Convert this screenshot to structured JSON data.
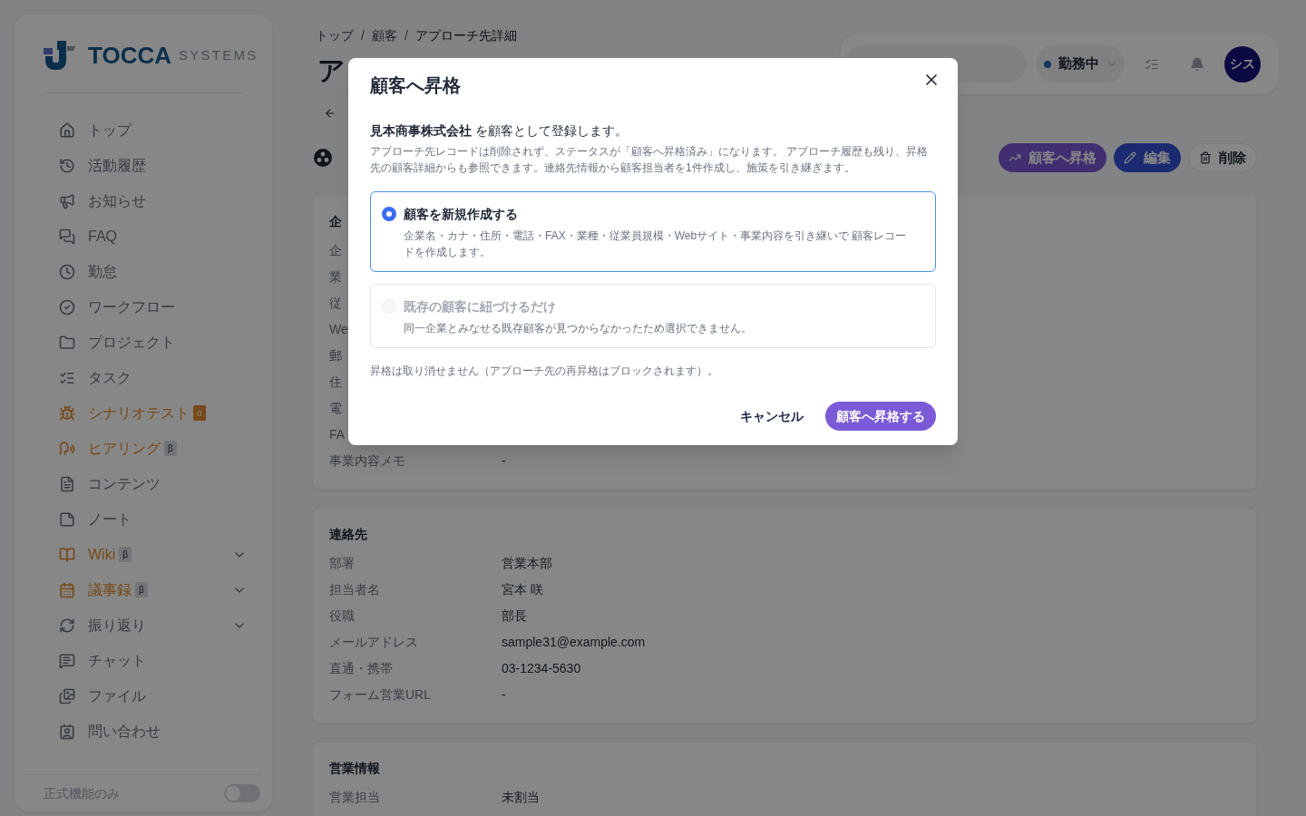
{
  "sidebar": {
    "logo": {
      "name": "TOCCA",
      "suffix": "SYSTEMS"
    },
    "items": [
      {
        "label": "トップ",
        "kind": "link"
      },
      {
        "label": "活動履歴",
        "kind": "link"
      },
      {
        "label": "お知らせ",
        "kind": "link"
      },
      {
        "label": "FAQ",
        "kind": "link"
      },
      {
        "label": "勤怠",
        "kind": "link"
      },
      {
        "label": "ワークフロー",
        "kind": "link"
      },
      {
        "label": "プロジェクト",
        "kind": "link"
      },
      {
        "label": "タスク",
        "kind": "link"
      },
      {
        "label": "シナリオテスト",
        "kind": "link",
        "badge": {
          "text": "α",
          "kind": "alpha"
        }
      },
      {
        "label": "ヒアリング",
        "kind": "link",
        "badge": {
          "text": "β",
          "kind": "beta"
        }
      },
      {
        "label": "コンテンツ",
        "kind": "link"
      },
      {
        "label": "ノート",
        "kind": "link"
      },
      {
        "label": "Wiki",
        "kind": "group",
        "expanded": false,
        "badge": {
          "text": "β",
          "kind": "beta"
        }
      },
      {
        "label": "議事録",
        "kind": "group",
        "expanded": false,
        "badge": {
          "text": "β",
          "kind": "beta"
        }
      },
      {
        "label": "振り返り",
        "kind": "group",
        "expanded": false
      },
      {
        "label": "チャット",
        "kind": "link"
      },
      {
        "label": "ファイル",
        "kind": "link"
      },
      {
        "label": "問い合わせ",
        "kind": "link"
      }
    ],
    "footer": {
      "label": "正式機能のみ",
      "toggle": {
        "on": false
      }
    }
  },
  "breadcrumbs": [
    {
      "label": "トップ",
      "kind": "link"
    },
    {
      "label": "/",
      "kind": "separator"
    },
    {
      "label": "顧客",
      "kind": "link"
    },
    {
      "label": "/",
      "kind": "separator"
    },
    {
      "label": "アプローチ先詳細",
      "kind": "current"
    }
  ],
  "page_title": "ア",
  "header": {
    "status": {
      "label": "勤務中"
    },
    "avatar": {
      "initials": "シス"
    }
  },
  "actions": [
    {
      "label": "顧客へ昇格",
      "kind": "promote"
    },
    {
      "label": "編集",
      "kind": "edit"
    },
    {
      "label": "削除",
      "kind": "delete"
    }
  ],
  "sections": [
    {
      "title": "企",
      "rows": [
        {
          "label": "企"
        },
        {
          "label": "業"
        },
        {
          "label": "従"
        },
        {
          "label": "We"
        },
        {
          "label": "郵"
        },
        {
          "label": "住"
        },
        {
          "label": "電"
        },
        {
          "label": "FA"
        },
        {
          "label": "事業内容メモ",
          "value": "-"
        }
      ]
    },
    {
      "title": "連絡先",
      "rows": [
        {
          "label": "部署",
          "value": "営業本部"
        },
        {
          "label": "担当者名",
          "value": "宮本 咲"
        },
        {
          "label": "役職",
          "value": "部長"
        },
        {
          "label": "メールアドレス",
          "value": "sample31@example.com"
        },
        {
          "label": "直通・携帯",
          "value": "03-1234-5630"
        },
        {
          "label": "フォーム営業URL",
          "value": "-"
        }
      ]
    },
    {
      "title": "営業情報",
      "rows": [
        {
          "label": "営業担当",
          "value": "未割当"
        }
      ]
    }
  ],
  "modal": {
    "title": "顧客へ昇格",
    "intro": "**見本商事株式会社** を顧客として登録します。",
    "description": "アプローチ先レコードは削除されず、ステータスが「顧客へ昇格済み」になります。 アプローチ履歴も残り、昇格先の顧客詳細からも参照できます。連絡先情報から顧客担当者を1件作成し、施策を引き継ぎます。",
    "options": [
      {
        "title": "顧客を新規作成する",
        "description": "企業名・カナ・住所・電話・FAX・業種・従業員規模・Webサイト・事業内容を引き継いで 顧客レコードを作成します。",
        "selected": true,
        "disabled": false
      },
      {
        "title": "既存の顧客に紐づけるだけ",
        "description": "同一企業とみなせる既存顧客が見つからなかったため選択できません。",
        "selected": false,
        "disabled": true
      }
    ],
    "note": "昇格は取り消せません（アプローチ先の再昇格はブロックされます）。",
    "buttons": [
      {
        "label": "キャンセル",
        "kind": "secondary"
      },
      {
        "label": "顧客へ昇格する",
        "kind": "primary"
      }
    ]
  }
}
